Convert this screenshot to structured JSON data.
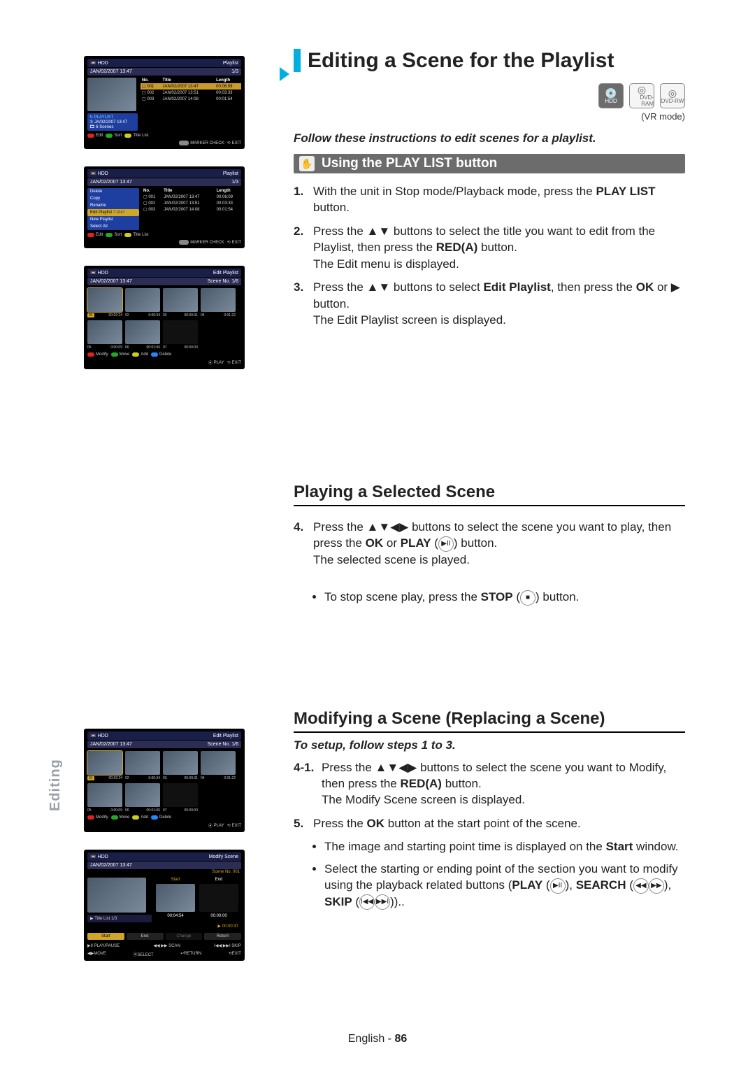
{
  "page": {
    "side_tab": "Editing",
    "footer_lang": "English",
    "footer_page": "86"
  },
  "main": {
    "title": "Editing a Scene for the Playlist",
    "mode_icons": [
      "HDD",
      "DVD-RAM",
      "DVD-RW"
    ],
    "mode_note": "(VR mode)",
    "follow_text": "Follow these instructions to edit scenes for a playlist.",
    "section1": {
      "band_label": "Using the PLAY LIST button",
      "steps": [
        {
          "n": "1.",
          "pre": "With the unit in Stop mode/Playback mode, press the ",
          "b": "PLAY LIST",
          "post": " button."
        },
        {
          "n": "2.",
          "pre": "Press the ",
          "arrows": "▲▼",
          "mid": " buttons to select the title you want to edit from the Playlist, then press the ",
          "b": "RED(A)",
          "post": " button.",
          "line2": "The Edit menu is displayed."
        },
        {
          "n": "3.",
          "pre": "Press the ",
          "arrows": "▲▼",
          "mid": " buttons to select ",
          "b": "Edit Playlist",
          "post": ", then press the ",
          "b2": "OK",
          "post2": " or ▶ button.",
          "line2": "The Edit Playlist screen is displayed."
        }
      ]
    },
    "section2": {
      "title": "Playing a Selected Scene",
      "step": {
        "n": "4.",
        "pre": "Press the ",
        "arrows": "▲▼◀▶",
        "mid": " buttons to select the scene you want to play, then press the ",
        "b": "OK",
        "mid2": " or ",
        "b2": "PLAY",
        "post": " button.",
        "line2": "The selected scene is played."
      },
      "bullet": {
        "pre": "To stop scene play, press the ",
        "b": "STOP",
        "post": " button."
      }
    },
    "section3": {
      "title": "Modifying a Scene (Replacing a Scene)",
      "setup_note": "To setup, follow steps 1 to 3.",
      "step4_1": {
        "n": "4-1.",
        "pre": "Press the ",
        "arrows": "▲▼◀▶",
        "mid": " buttons to select the scene you want to Modify, then press the ",
        "b": "RED(A)",
        "post": " button.",
        "line2": "The Modify Scene screen is displayed."
      },
      "step5": {
        "n": "5.",
        "pre": "Press the ",
        "b": "OK",
        "post": " button at the start point of the scene."
      },
      "bullets": [
        {
          "pre": "The image and starting point time is displayed on the ",
          "b": "Start",
          "post": " window."
        },
        {
          "pre": "Select the starting or ending point of the section you want to modify using the playback related buttons (",
          "b": "PLAY",
          "mid": ", ",
          "b2": "SEARCH",
          "mid2": ", ",
          "b3": "SKIP",
          "post": ")."
        }
      ]
    }
  },
  "osd": {
    "hdd_label": "HDD",
    "playlist_label": "Playlist",
    "datetime": "JAN/02/2007 13:47",
    "count13": "1/3",
    "tbl_headers": {
      "no": "No.",
      "title": "Title",
      "len": "Length"
    },
    "rows": [
      {
        "no": "001",
        "title": "JAN/02/2007 13:47",
        "len": "00:06:09"
      },
      {
        "no": "002",
        "title": "JAN/02/2007 13:51",
        "len": "00:03:33"
      },
      {
        "no": "003",
        "title": "JAN/02/2007 14:08",
        "len": "00:01:54"
      }
    ],
    "side_info": {
      "pl": "PLAYLIST",
      "dt": "JA/02/2007 13:47",
      "scenes": "6 Scenes"
    },
    "foot1": {
      "a": "Edit",
      "b": "Sort",
      "c": "Title List",
      "m": "MARKER CHECK",
      "e": "EXIT"
    },
    "edit_menu": [
      "Delete",
      "Copy",
      "Rename",
      "Edit Playlist",
      "New Playlist",
      "Select All"
    ],
    "edit_menu_sel": "Edit Playlist",
    "edit_menu_right": "7 13:47",
    "edit_playlist_label": "Edit Playlist",
    "scene_no_label": "Scene No. 1/6",
    "scenes": [
      {
        "n": "01",
        "t": "00:02:24",
        "hl": true
      },
      {
        "n": "02",
        "t": "0:00:34"
      },
      {
        "n": "03",
        "t": "00:00:31"
      },
      {
        "n": "04",
        "t": "0:01:22"
      },
      {
        "n": "05",
        "t": "0:00:09"
      },
      {
        "n": "06",
        "t": "00:01:06"
      },
      {
        "n": "07",
        "t": "00:00:00"
      }
    ],
    "foot3": {
      "a": "Modify",
      "b": "Move",
      "c": "Add",
      "d": "Delete",
      "p": "PLAY",
      "e": "EXIT"
    },
    "modify_scene_label": "Modify Scene",
    "ms": {
      "scene_no": "Scene No. 001",
      "start": "Start",
      "end": "End",
      "title_list_label": "Title List 1/3",
      "main_time": "00:04:54",
      "end_time": "00:00:00",
      "cur": "00:00:37",
      "btns": [
        "Start",
        "End",
        "Change",
        "Return"
      ],
      "foot": {
        "pp": "▶II PLAY/PAUSE",
        "scan": "◀◀ ▶▶ SCAN",
        "skip": "I◀◀ ▶▶I SKIP",
        "move": "◀▶MOVE",
        "sel": "SELECT",
        "ret": "RETURN",
        "exit": "EXIT"
      }
    }
  }
}
